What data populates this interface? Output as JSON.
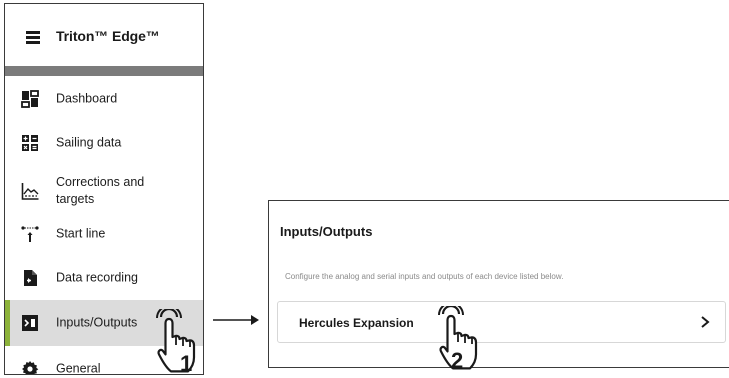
{
  "app": {
    "title": "Triton™ Edge™"
  },
  "sidebar": {
    "items": [
      {
        "label": "Dashboard",
        "icon": "dashboard-icon"
      },
      {
        "label": "Sailing data",
        "icon": "sailing-data-icon"
      },
      {
        "label": "Corrections and targets",
        "icon": "corrections-icon"
      },
      {
        "label": "Start line",
        "icon": "start-line-icon"
      },
      {
        "label": "Data recording",
        "icon": "data-recording-icon"
      },
      {
        "label": "Inputs/Outputs",
        "icon": "inputs-outputs-icon",
        "active": true
      },
      {
        "label": "General",
        "icon": "gear-icon"
      }
    ]
  },
  "io_page": {
    "title": "Inputs/Outputs",
    "description": "Configure the analog and serial inputs and outputs of each device listed below.",
    "devices": [
      {
        "name": "Hercules Expansion"
      }
    ]
  },
  "callouts": {
    "step1": "1",
    "step2": "2"
  },
  "colors": {
    "active_accent": "#8cb23a",
    "active_bg": "#dcdcdc",
    "divider": "#7b7b7b"
  }
}
